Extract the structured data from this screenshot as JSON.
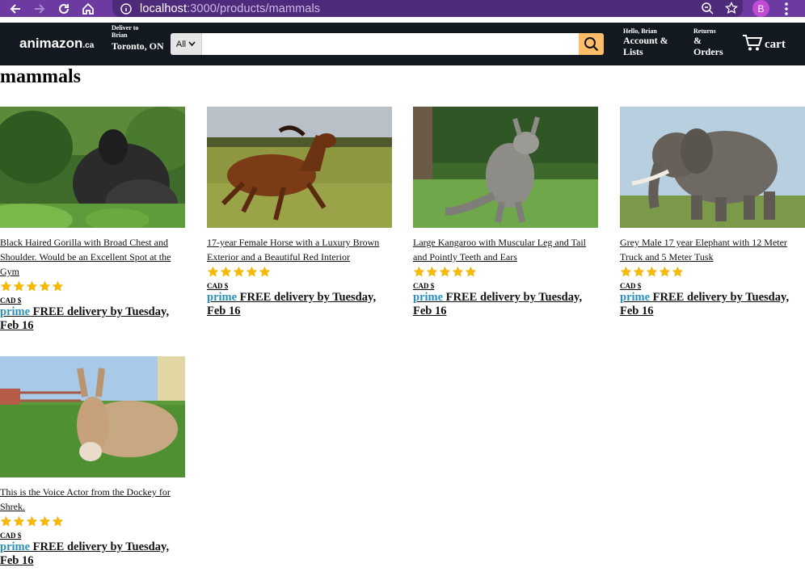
{
  "browser": {
    "url_host": "localhost",
    "url_path": ":3000/products/mammals",
    "profile_initial": "B"
  },
  "header": {
    "logo": "animazon",
    "logo_suffix": ".ca",
    "deliver_line1": "Deliver to Brian",
    "deliver_line2": "Toronto, ON",
    "search_category": "All",
    "search_placeholder": "",
    "account_line1": "Hello, Brian",
    "account_line2": "Account & Lists",
    "returns_line1": "Returns",
    "returns_line2": "& Orders",
    "cart_label": "cart"
  },
  "page": {
    "title": "mammals"
  },
  "products": [
    {
      "title": "Black Haired Gorilla with Broad Chest and Shoulder. Would be an Excellent Spot at the Gym",
      "rating": 5,
      "price": "CAD $",
      "prime": "prime",
      "delivery": " FREE delivery by Tuesday, Feb 16",
      "image": "gorilla-photo"
    },
    {
      "title": "17-year Female Horse with a Luxury Brown Exterior and a Beautiful Red Interior",
      "rating": 5,
      "price": "CAD $",
      "prime": "prime",
      "delivery": " FREE delivery by Tuesday, Feb 16",
      "image": "horse-photo"
    },
    {
      "title": "Large Kangaroo with Muscular Leg and Tail and Pointly Teeth and Ears",
      "rating": 5,
      "price": "CAD $",
      "prime": "prime",
      "delivery": " FREE delivery by Tuesday, Feb 16",
      "image": "kangaroo-photo"
    },
    {
      "title": "Grey Male 17 year Elephant with 12 Meter Truck and 5 Meter Tusk",
      "rating": 5,
      "price": "CAD $",
      "prime": "prime",
      "delivery": " FREE delivery by Tuesday, Feb 16",
      "image": "elephant-photo"
    },
    {
      "title": "This is the Voice Actor from the Dockey for Shrek.",
      "rating": 5,
      "price": "CAD $",
      "prime": "prime",
      "delivery": " FREE delivery by Tuesday, Feb 16",
      "image": "donkey-photo"
    }
  ],
  "colors": {
    "chrome": "#6c3aa0",
    "header_bg": "#131921",
    "search_button": "#febd69",
    "star": "#f5b90e",
    "prime": "#2a8fbd"
  }
}
